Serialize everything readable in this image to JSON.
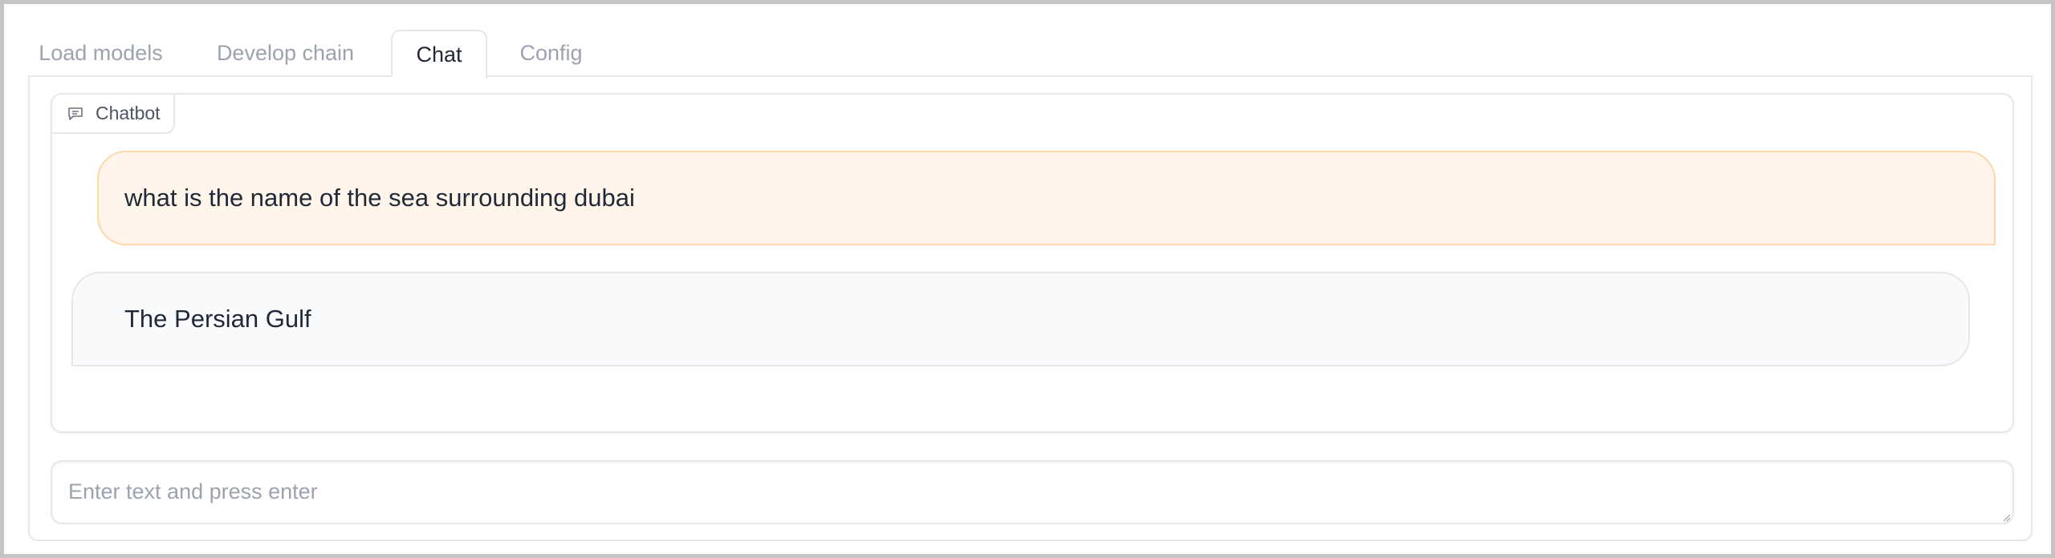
{
  "tabs": [
    {
      "label": "Load models",
      "active": false
    },
    {
      "label": "Develop chain",
      "active": false
    },
    {
      "label": "Chat",
      "active": true
    },
    {
      "label": "Config",
      "active": false
    }
  ],
  "chatbot": {
    "label": "Chatbot",
    "icon": "chat-icon",
    "messages": [
      {
        "role": "user",
        "text": "what is the name of the sea surrounding dubai"
      },
      {
        "role": "bot",
        "text": "The Persian Gulf"
      }
    ]
  },
  "input": {
    "value": "",
    "placeholder": "Enter text and press enter"
  },
  "colors": {
    "user_bubble": "#fff5eb",
    "user_bubble_border": "#fed7aa",
    "bot_bubble": "#f9fafb",
    "border": "#e5e7eb"
  }
}
